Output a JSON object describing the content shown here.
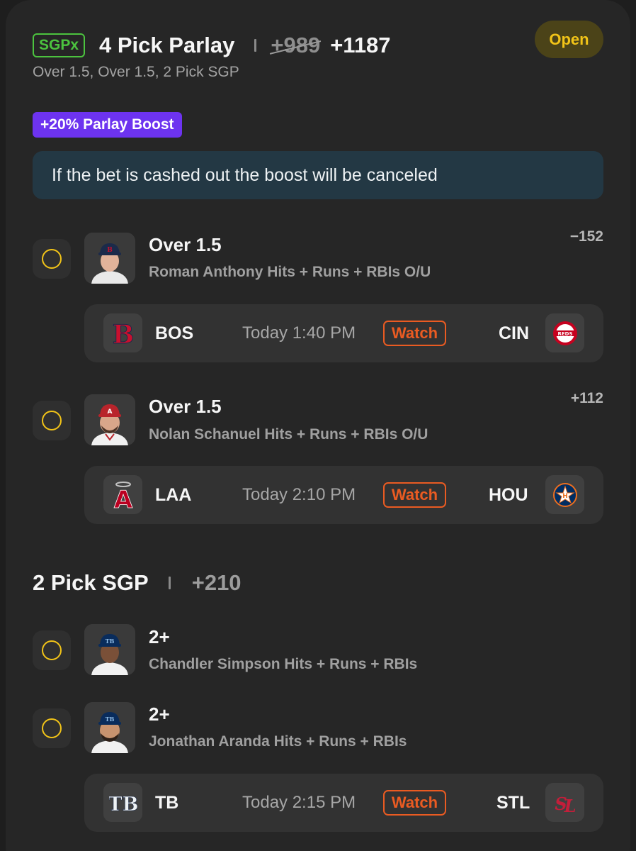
{
  "header": {
    "badge": "SGPx",
    "title": "4 Pick Parlay",
    "old_odds": "+989",
    "new_odds": "+1187",
    "subtitle": "Over 1.5, Over 1.5, 2 Pick SGP",
    "status": "Open"
  },
  "boost": {
    "label": "+20% Parlay Boost",
    "notice": "If the bet is cashed out the boost will be canceled"
  },
  "picks": [
    {
      "title": "Over 1.5",
      "desc": "Roman Anthony Hits + Runs + RBIs O/U",
      "odds": "−152",
      "cap_color": "#1b2a4a",
      "letter": "B"
    },
    {
      "title": "Over 1.5",
      "desc": "Nolan Schanuel Hits + Runs + RBIs O/U",
      "odds": "+112",
      "cap_color": "#b8242b",
      "letter": "A"
    }
  ],
  "games": [
    {
      "away": "BOS",
      "time": "Today 1:40 PM",
      "watch": "Watch",
      "home": "CIN",
      "away_icon": "red-sox-logo-icon",
      "home_icon": "reds-logo-icon"
    },
    {
      "away": "LAA",
      "time": "Today 2:10 PM",
      "watch": "Watch",
      "home": "HOU",
      "away_icon": "angels-logo-icon",
      "home_icon": "astros-logo-icon"
    },
    {
      "away": "TB",
      "time": "Today 2:15 PM",
      "watch": "Watch",
      "home": "STL",
      "away_icon": "rays-logo-icon",
      "home_icon": "cardinals-logo-icon"
    }
  ],
  "sgp": {
    "title": "2 Pick SGP",
    "odds": "+210",
    "picks": [
      {
        "title": "2+",
        "desc": "Chandler Simpson Hits + Runs + RBIs"
      },
      {
        "title": "2+",
        "desc": "Jonathan Aranda Hits + Runs + RBIs"
      }
    ]
  },
  "colors": {
    "accent_yellow": "#f2c418",
    "boost_purple": "#6d33f0",
    "sgpx_green": "#4cc33f",
    "watch_orange": "#ea5b22"
  }
}
